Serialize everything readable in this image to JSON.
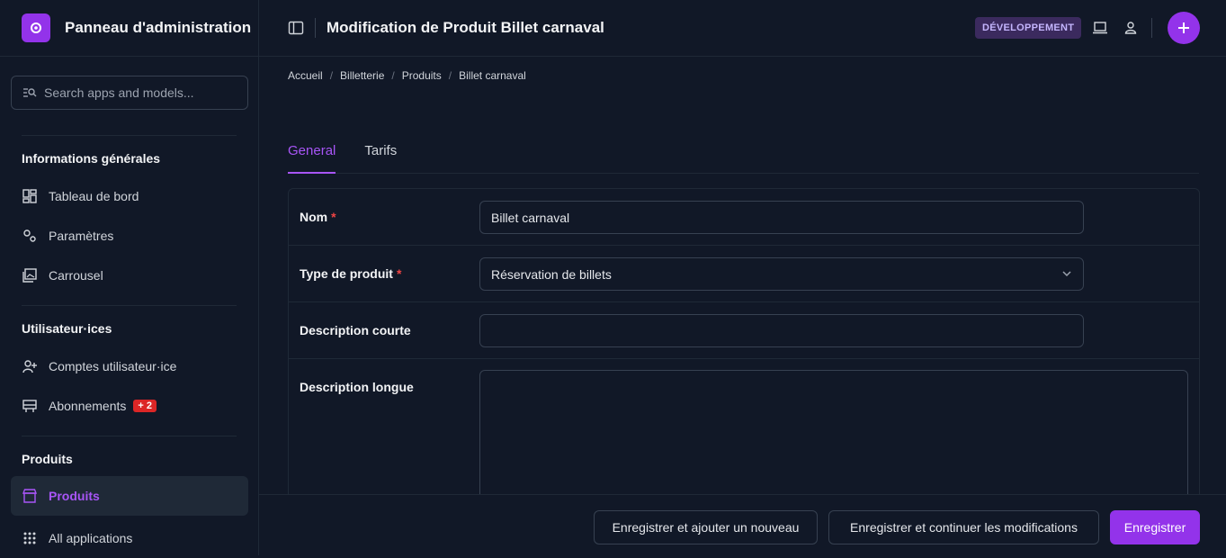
{
  "brand": {
    "title": "Panneau d'administration"
  },
  "search": {
    "placeholder": "Search apps and models..."
  },
  "sidebar": {
    "groups": [
      {
        "title": "Informations générales",
        "items": [
          {
            "label": "Tableau de bord",
            "icon": "dashboard-icon"
          },
          {
            "label": "Paramètres",
            "icon": "settings-icon"
          },
          {
            "label": "Carrousel",
            "icon": "carousel-icon"
          }
        ]
      },
      {
        "title": "Utilisateur·ices",
        "items": [
          {
            "label": "Comptes utilisateur·ice",
            "icon": "user-add-icon"
          },
          {
            "label": "Abonnements",
            "icon": "subscription-icon",
            "badge": "+ 2"
          }
        ]
      },
      {
        "title": "Produits",
        "items": [
          {
            "label": "Produits",
            "icon": "store-icon",
            "active": true
          }
        ]
      }
    ],
    "all_apps": "All applications"
  },
  "header": {
    "title": "Modification de Produit Billet carnaval",
    "env_badge": "DÉVELOPPEMENT"
  },
  "breadcrumb": [
    "Accueil",
    "Billetterie",
    "Produits",
    "Billet carnaval"
  ],
  "tabs": [
    {
      "label": "General",
      "active": true
    },
    {
      "label": "Tarifs",
      "active": false
    }
  ],
  "form": {
    "nom": {
      "label": "Nom",
      "required": "*",
      "value": "Billet carnaval"
    },
    "type": {
      "label": "Type de produit",
      "required": "*",
      "value": "Réservation de billets"
    },
    "desc_courte": {
      "label": "Description courte",
      "value": ""
    },
    "desc_longue": {
      "label": "Description longue",
      "value": ""
    }
  },
  "footer": {
    "save_add": "Enregistrer et ajouter un nouveau",
    "save_continue": "Enregistrer et continuer les modifications",
    "save": "Enregistrer"
  },
  "colors": {
    "accent": "#9333ea",
    "background": "#111827",
    "danger": "#dc2626"
  }
}
